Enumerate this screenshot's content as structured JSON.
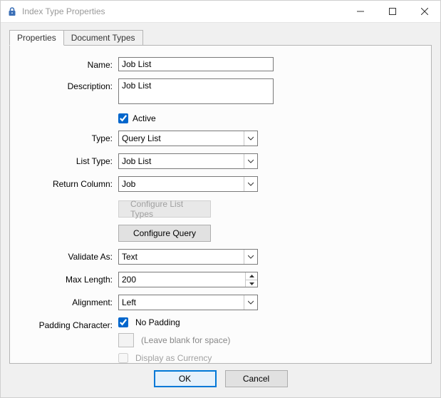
{
  "window": {
    "title": "Index Type Properties"
  },
  "tabs": {
    "properties": "Properties",
    "document_types": "Document Types"
  },
  "labels": {
    "name": "Name:",
    "description": "Description:",
    "active": "Active",
    "type": "Type:",
    "list_type": "List Type:",
    "return_column": "Return Column:",
    "validate_as": "Validate As:",
    "max_length": "Max Length:",
    "alignment": "Alignment:",
    "padding_character": "Padding Character:",
    "no_padding": "No Padding",
    "leave_blank": "(Leave blank for space)",
    "display_currency": "Display as Currency"
  },
  "buttons": {
    "configure_list_types": "Configure List Types",
    "configure_query": "Configure Query",
    "ok": "OK",
    "cancel": "Cancel"
  },
  "values": {
    "name": "Job List",
    "description": "Job List",
    "active": true,
    "type": "Query List",
    "list_type": "Job List",
    "return_column": "Job",
    "validate_as": "Text",
    "max_length": "200",
    "alignment": "Left",
    "no_padding": true,
    "padding_char": "",
    "display_currency": false
  }
}
